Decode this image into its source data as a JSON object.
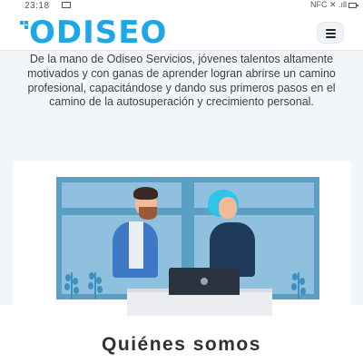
{
  "status_bar": {
    "time": "23:18",
    "indicators": "NFC ✕ .ıll"
  },
  "header": {
    "logo_text": "ODISEO",
    "menu_icon": "hamburger-menu-icon"
  },
  "hero": {
    "description": "De la mano de Odiseo Servicios, jóvenes talentos altamente motivados y con ganas de aprender logran abrirse un camino profesional, capacitándose y dando sus primeros pasos en el camino de la autosuperación y crecimiento personal.",
    "illustration": "two-people-working-at-laptop-illustration"
  },
  "section": {
    "title": "Quiénes somos"
  },
  "colors": {
    "brand": "#1fa6e6",
    "hero_bg": "#f3f6f9",
    "window_blue": "#5b9fc5"
  }
}
